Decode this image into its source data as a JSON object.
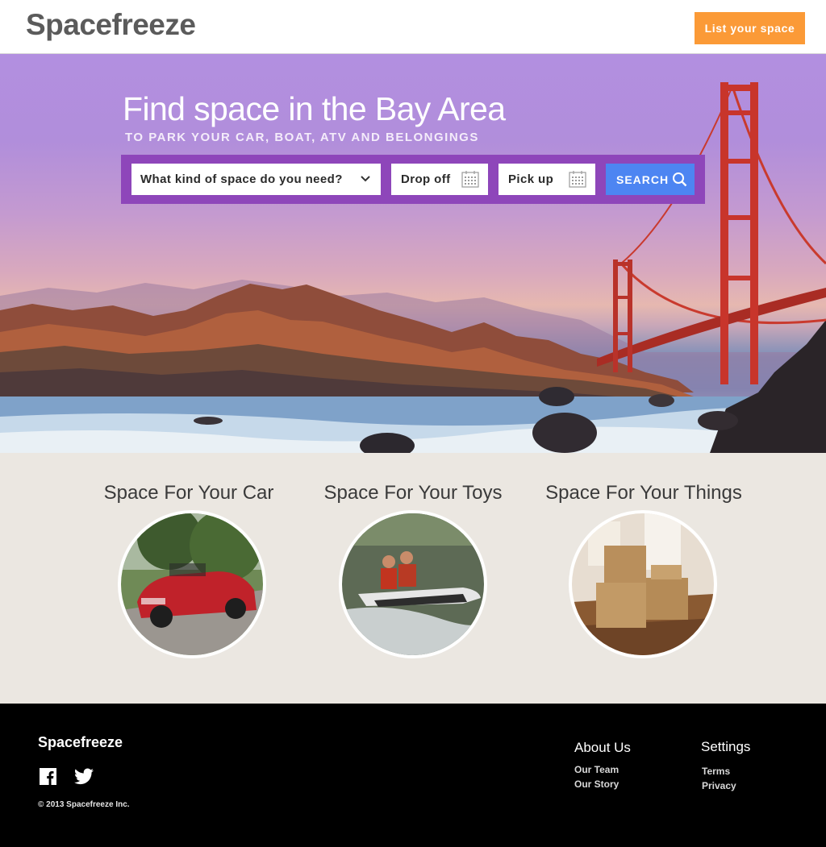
{
  "header": {
    "logo": "Spacefreeze",
    "list_button": "List your space"
  },
  "hero": {
    "title": "Find space in the Bay Area",
    "subtitle": "TO PARK YOUR CAR, BOAT, ATV AND BELONGINGS",
    "search": {
      "kind_placeholder": "What kind of space do you need?",
      "dropoff_label": "Drop off",
      "pickup_label": "Pick up",
      "search_label": "SEARCH"
    }
  },
  "categories": [
    {
      "title": "Space For Your Car"
    },
    {
      "title": "Space For Your Toys"
    },
    {
      "title": "Space For Your Things"
    }
  ],
  "footer": {
    "brand": "Spacefreeze",
    "copyright": "© 2013  Spacefreeze Inc.",
    "about": {
      "heading": "About Us",
      "links": [
        "Our Team",
        "Our Story"
      ]
    },
    "settings": {
      "heading": "Settings",
      "links": [
        "Terms",
        "Privacy"
      ]
    }
  },
  "colors": {
    "accent_orange": "#fb9a37",
    "search_bar_purple": "#8e46ba",
    "search_button_blue": "#4d85f2",
    "category_bg": "#ebe7e1"
  },
  "icons": [
    "chevron-down-icon",
    "calendar-icon",
    "search-icon",
    "facebook-icon",
    "twitter-icon"
  ]
}
